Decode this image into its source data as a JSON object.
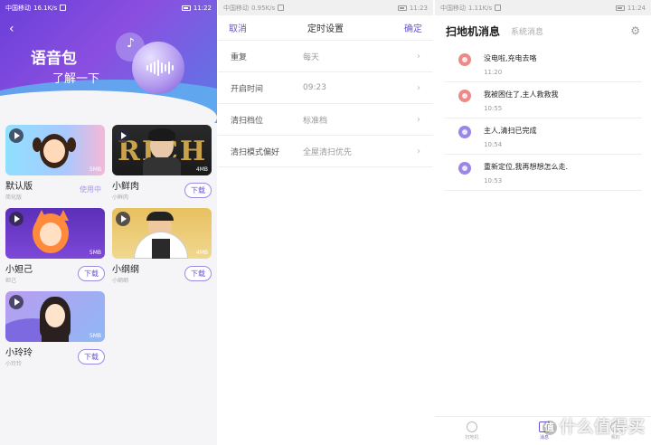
{
  "status_bars": [
    {
      "carrier": "中国移动",
      "speed": "16.1K/s",
      "time": "11:22"
    },
    {
      "carrier": "中国移动",
      "speed": "0.95K/s",
      "time": "11:23"
    },
    {
      "carrier": "中国移动",
      "speed": "1.11K/s",
      "time": "11:24"
    }
  ],
  "voice_pack": {
    "title": "语音包",
    "subtitle": "了解一下",
    "cards": [
      {
        "name": "默认版",
        "sub": "简化版",
        "status": "使用中",
        "size": "5MB"
      },
      {
        "name": "小鲜肉",
        "sub": "小鲜肉",
        "button": "下载",
        "size": "4MB",
        "img_text": "RICH"
      },
      {
        "name": "小妲己",
        "sub": "妲己",
        "button": "下载",
        "size": "5MB"
      },
      {
        "name": "小纲纲",
        "sub": "小纲纲",
        "button": "下载",
        "size": "4MB"
      },
      {
        "name": "小玲玲",
        "sub": "小玲玲",
        "button": "下载",
        "size": "5MB"
      }
    ]
  },
  "timer": {
    "cancel": "取消",
    "title": "定时设置",
    "confirm": "确定",
    "rows": [
      {
        "label": "重复",
        "value": "每天"
      },
      {
        "label": "开启时间",
        "value": "09:23"
      },
      {
        "label": "清扫档位",
        "value": "标准档"
      },
      {
        "label": "清扫模式偏好",
        "value": "全屋清扫优先"
      }
    ]
  },
  "messages": {
    "tab_active": "扫地机消息",
    "tab_inactive": "系统消息",
    "items": [
      {
        "text": "没电啦,充电去咯",
        "time": "11:20",
        "color": "#ec8a8a"
      },
      {
        "text": "我被困住了,主人救救我",
        "time": "10:55",
        "color": "#ec8a8a"
      },
      {
        "text": "主人,清扫已完成",
        "time": "10:54",
        "color": "#9b86e6"
      },
      {
        "text": "重新定位,我再想想怎么走.",
        "time": "10:53",
        "color": "#9b86e6"
      }
    ],
    "bottom_nav": [
      {
        "label": "扫地机"
      },
      {
        "label": "消息"
      },
      {
        "label": "我的"
      }
    ]
  },
  "watermark": "什么值得买",
  "colors": {
    "accent": "#6b54d8",
    "banner_start": "#6a3fd8",
    "banner_end": "#5a7ae6"
  }
}
